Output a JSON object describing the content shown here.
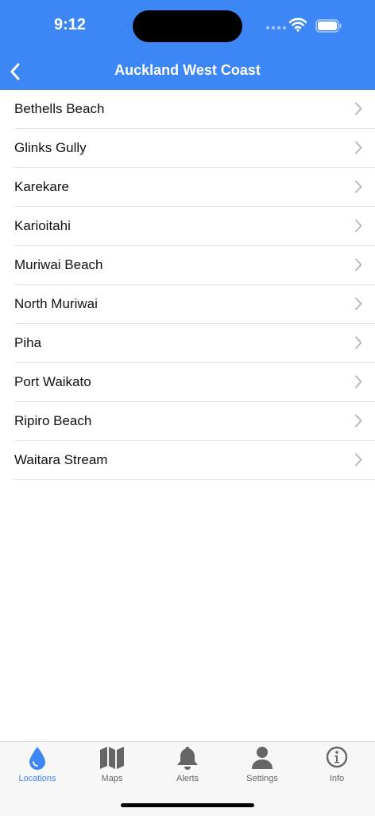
{
  "status_bar": {
    "time": "9:12"
  },
  "nav": {
    "title": "Auckland West Coast",
    "back_icon": "chevron-left-icon"
  },
  "locations": [
    {
      "label": "Bethells Beach"
    },
    {
      "label": "Glinks Gully"
    },
    {
      "label": "Karekare"
    },
    {
      "label": "Karioitahi"
    },
    {
      "label": "Muriwai Beach"
    },
    {
      "label": "North Muriwai"
    },
    {
      "label": "Piha"
    },
    {
      "label": "Port Waikato"
    },
    {
      "label": "Ripiro Beach"
    },
    {
      "label": "Waitara Stream"
    }
  ],
  "tabs": [
    {
      "label": "Locations",
      "icon": "water-drop-icon",
      "active": true
    },
    {
      "label": "Maps",
      "icon": "map-icon",
      "active": false
    },
    {
      "label": "Alerts",
      "icon": "bell-icon",
      "active": false
    },
    {
      "label": "Settings",
      "icon": "person-icon",
      "active": false
    },
    {
      "label": "Info",
      "icon": "info-icon",
      "active": false
    }
  ],
  "colors": {
    "accent": "#3d86f6",
    "tab_inactive": "#666666",
    "chevron": "#b9b9bd"
  }
}
